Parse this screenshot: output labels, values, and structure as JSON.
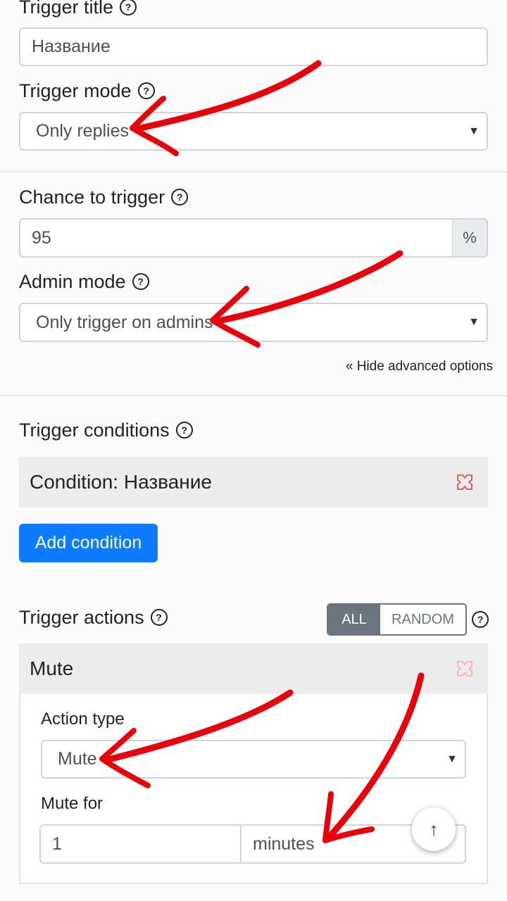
{
  "trigger_title": {
    "label": "Trigger title",
    "value": "Название"
  },
  "trigger_mode": {
    "label": "Trigger mode",
    "selected": "Only replies"
  },
  "chance": {
    "label": "Chance to trigger",
    "value": "95",
    "unit": "%"
  },
  "admin_mode": {
    "label": "Admin mode",
    "selected": "Only trigger on admins"
  },
  "hide_advanced": "« Hide advanced options",
  "conditions": {
    "label": "Trigger conditions",
    "items": [
      {
        "title": "Condition: Название"
      }
    ],
    "add_label": "Add condition"
  },
  "actions": {
    "label": "Trigger actions",
    "toggle": {
      "all": "ALL",
      "random": "RANDOM",
      "active": "ALL"
    },
    "items": [
      {
        "title": "Mute",
        "type_label": "Action type",
        "type_value": "Mute",
        "duration_label": "Mute for",
        "duration_value": "1",
        "duration_unit": "minutes"
      }
    ]
  },
  "scroll_top_glyph": "↑",
  "colors": {
    "arrow": "#e8000b",
    "primary": "#0d7bff",
    "toggle_active": "#6c757d",
    "remove_icon": "#e06060"
  }
}
